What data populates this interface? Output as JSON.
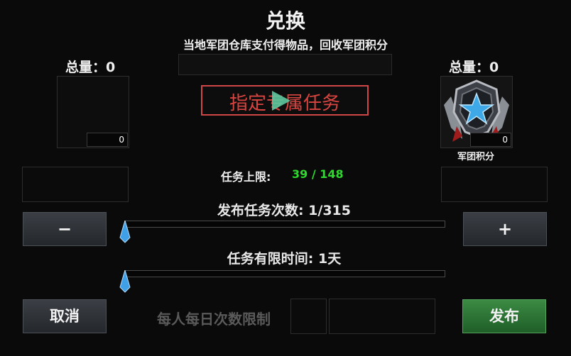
{
  "dialog": {
    "title": "兑换",
    "subtitle": "当地军团仓库支付得物品，回收军团积分"
  },
  "left_panel": {
    "total_label": "总量：0",
    "slot_count": "0"
  },
  "right_panel": {
    "total_label": "总量：0",
    "slot_count": "0",
    "item_name": "军团积分",
    "icon": "legion-medal-star-icon"
  },
  "task_banner": {
    "label": "指定专属任务",
    "icon": "play-icon"
  },
  "task_limit": {
    "label": "任务上限:",
    "value": "39 / 148"
  },
  "publish_count": {
    "label": "发布任务次数: 1/315",
    "value_fraction": 0
  },
  "time_limit": {
    "label": "任务有限时间: 1天",
    "value_fraction": 0
  },
  "buttons": {
    "minus": "−",
    "plus": "+",
    "cancel": "取消",
    "publish": "发布"
  },
  "daily_limit": {
    "label": "每人每日次数限制"
  },
  "colors": {
    "task_limit_value": "#2ed82e",
    "banner_border": "#d04545",
    "publish_button": "#2f7a38"
  }
}
